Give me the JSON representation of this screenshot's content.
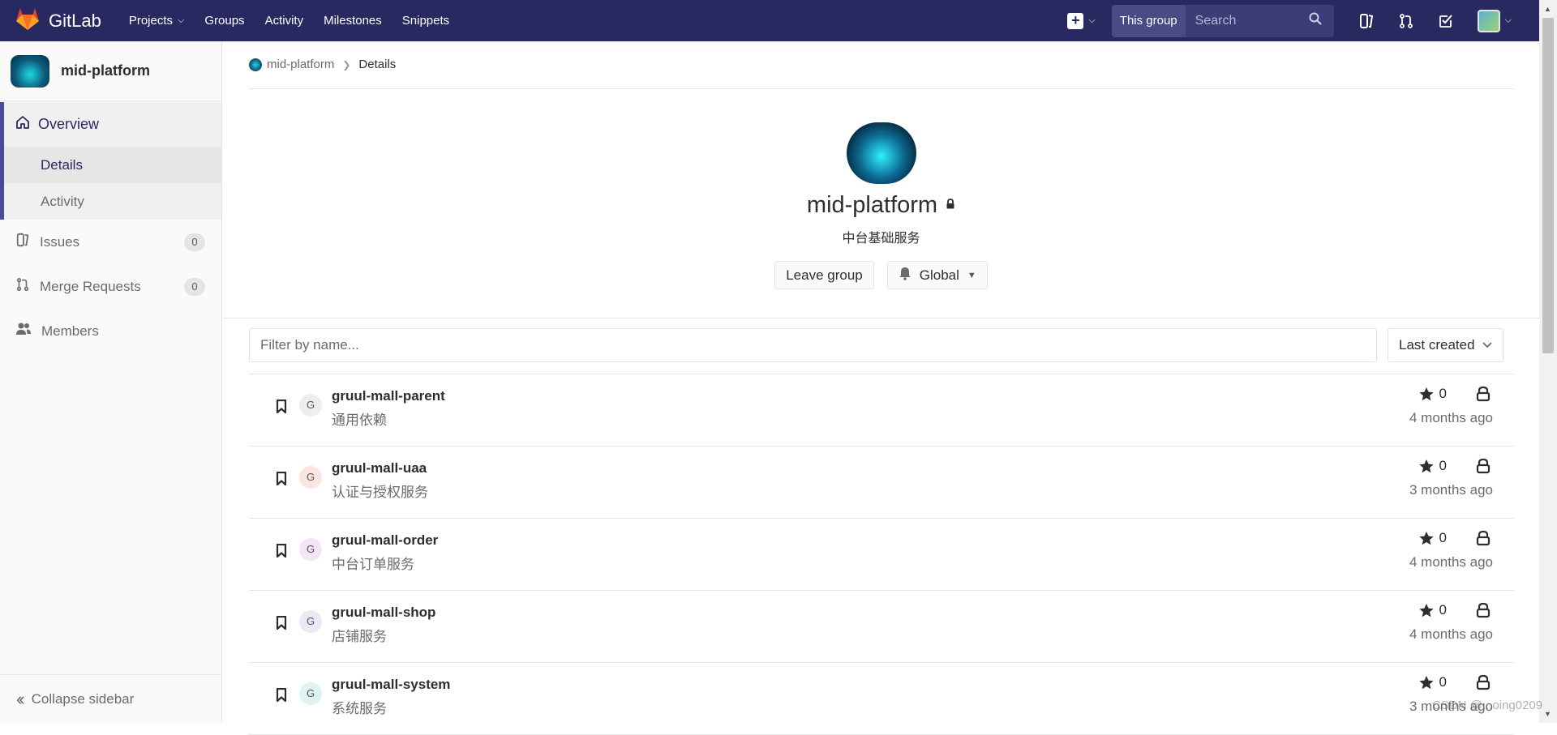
{
  "topbar": {
    "brand": "GitLab",
    "nav": [
      {
        "label": "Projects",
        "has_caret": true
      },
      {
        "label": "Groups",
        "has_caret": false
      },
      {
        "label": "Activity",
        "has_caret": false
      },
      {
        "label": "Milestones",
        "has_caret": false
      },
      {
        "label": "Snippets",
        "has_caret": false
      }
    ],
    "search_scope": "This group",
    "search_placeholder": "Search",
    "icons": [
      "plus-icon",
      "search-icon",
      "issues-icon",
      "merge-request-icon",
      "todo-icon",
      "user-avatar"
    ]
  },
  "sidebar": {
    "group_name": "mid-platform",
    "overview_label": "Overview",
    "sub_items": [
      "Details",
      "Activity"
    ],
    "items": [
      {
        "label": "Issues",
        "count": "0"
      },
      {
        "label": "Merge Requests",
        "count": "0"
      },
      {
        "label": "Members",
        "count": null
      }
    ],
    "collapse_label": "Collapse sidebar"
  },
  "breadcrumb": {
    "group": "mid-platform",
    "current": "Details"
  },
  "group": {
    "title": "mid-platform",
    "description": "中台基础服务",
    "leave_button": "Leave group",
    "notification_button": "Global"
  },
  "filter": {
    "placeholder": "Filter by name...",
    "sort_label": "Last created"
  },
  "projects": [
    {
      "initial": "G",
      "name": "gruul-mall-parent",
      "description": "通用依赖",
      "stars": "0",
      "updated": "4 months ago",
      "avatar_color": "#eeeeee"
    },
    {
      "initial": "G",
      "name": "gruul-mall-uaa",
      "description": "认证与授权服务",
      "stars": "0",
      "updated": "3 months ago",
      "avatar_color": "#fbe5e1"
    },
    {
      "initial": "G",
      "name": "gruul-mall-order",
      "description": "中台订单服务",
      "stars": "0",
      "updated": "4 months ago",
      "avatar_color": "#f3e5f5"
    },
    {
      "initial": "G",
      "name": "gruul-mall-shop",
      "description": "店铺服务",
      "stars": "0",
      "updated": "4 months ago",
      "avatar_color": "#e8eaf6"
    },
    {
      "initial": "G",
      "name": "gruul-mall-system",
      "description": "系统服务",
      "stars": "0",
      "updated": "3 months ago",
      "avatar_color": "#e0f2f1"
    }
  ],
  "colors": {
    "topbar": "#292961",
    "accent": "#4a4a9b"
  },
  "watermark": "CSDN @...oing0209"
}
